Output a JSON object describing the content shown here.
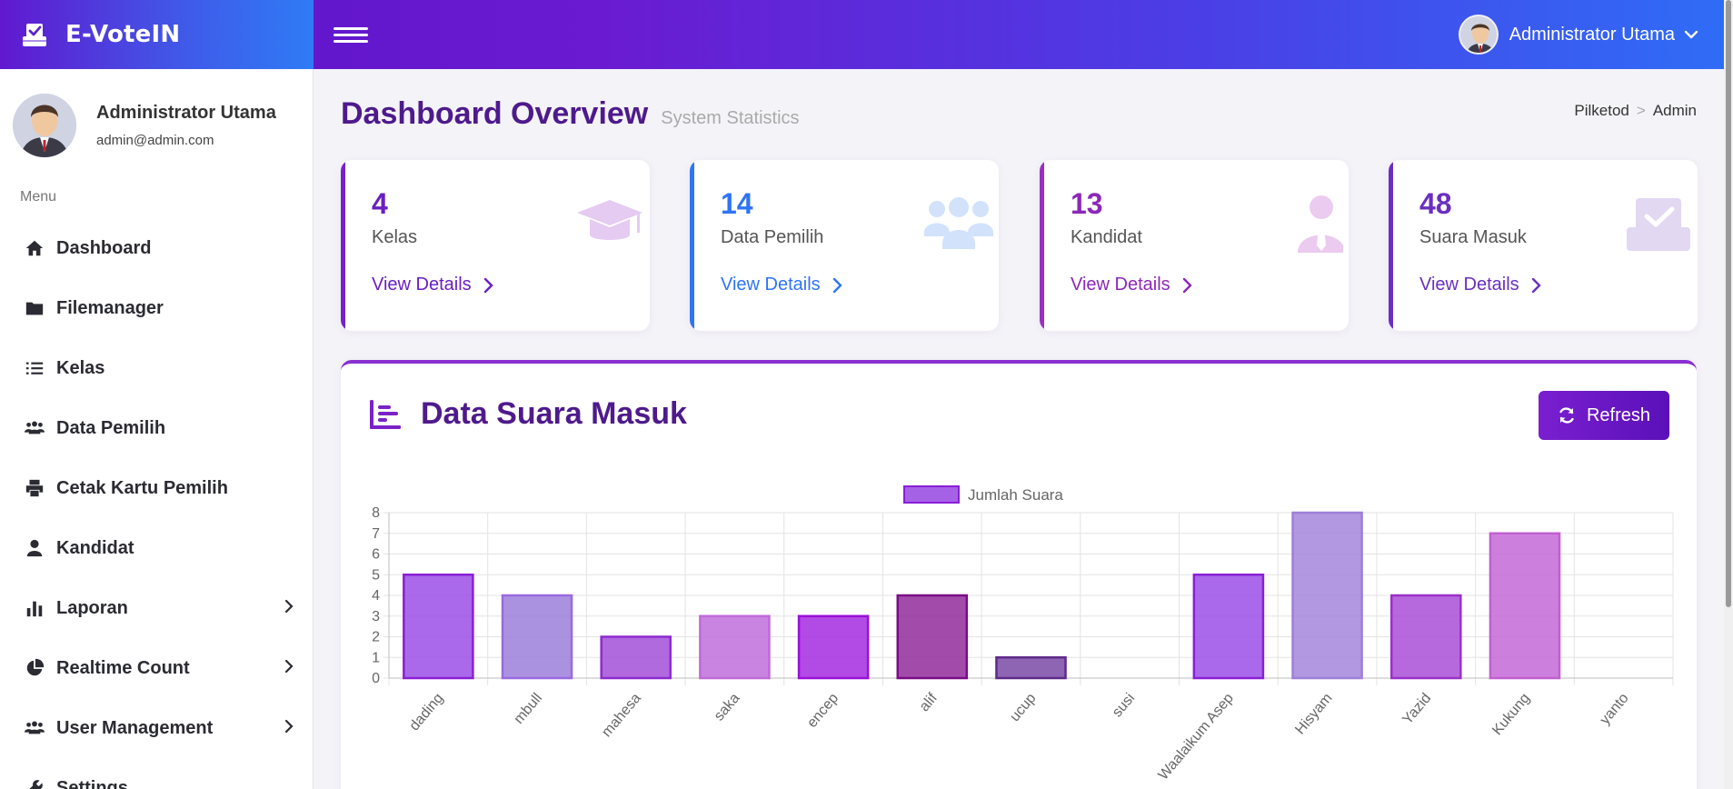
{
  "app": {
    "brand": "E-VoteIN"
  },
  "topbar": {
    "user_name": "Administrator Utama"
  },
  "sidebar": {
    "profile_name": "Administrator Utama",
    "profile_email": "admin@admin.com",
    "menu_heading": "Menu",
    "items": [
      {
        "label": "Dashboard",
        "icon": "home-icon",
        "has_submenu": false
      },
      {
        "label": "Filemanager",
        "icon": "folder-icon",
        "has_submenu": false
      },
      {
        "label": "Kelas",
        "icon": "list-icon",
        "has_submenu": false
      },
      {
        "label": "Data Pemilih",
        "icon": "users-icon",
        "has_submenu": false
      },
      {
        "label": "Cetak Kartu Pemilih",
        "icon": "printer-icon",
        "has_submenu": false
      },
      {
        "label": "Kandidat",
        "icon": "user-icon",
        "has_submenu": false
      },
      {
        "label": "Laporan",
        "icon": "bar-chart-icon",
        "has_submenu": true
      },
      {
        "label": "Realtime Count",
        "icon": "pie-chart-icon",
        "has_submenu": true
      },
      {
        "label": "User Management",
        "icon": "users-icon",
        "has_submenu": true
      },
      {
        "label": "Settings",
        "icon": "wrench-icon",
        "has_submenu": false
      }
    ]
  },
  "header": {
    "title": "Dashboard Overview",
    "subtitle": "System Statistics",
    "breadcrumb": [
      "Pilketod",
      "Admin"
    ]
  },
  "cards": [
    {
      "value": "4",
      "label": "Kelas",
      "link": "View Details",
      "color": "#7422c9",
      "icon": "graduation-cap-icon"
    },
    {
      "value": "14",
      "label": "Data Pemilih",
      "link": "View Details",
      "color": "#2f74f5",
      "icon": "users-icon"
    },
    {
      "value": "13",
      "label": "Kandidat",
      "link": "View Details",
      "color": "#9a2fc2",
      "icon": "user-tie-icon"
    },
    {
      "value": "48",
      "label": "Suara Masuk",
      "link": "View Details",
      "color": "#6a2fc0",
      "icon": "vote-box-icon"
    }
  ],
  "panel": {
    "title": "Data Suara Masuk",
    "refresh_label": "Refresh"
  },
  "chart_data": {
    "type": "bar",
    "categories": [
      "dading",
      "mbull",
      "mahesa",
      "saka",
      "encep",
      "alif",
      "ucup",
      "susi",
      "Waalaikum Asep",
      "Hisyam",
      "Yazid",
      "Kukung",
      "yanto"
    ],
    "series": [
      {
        "name": "Jumlah Suara",
        "values": [
          5,
          4,
          2,
          3,
          3,
          4,
          1,
          0,
          5,
          8,
          4,
          7,
          0
        ]
      }
    ],
    "ylim": [
      0,
      8
    ],
    "yticks": [
      0,
      1,
      2,
      3,
      4,
      5,
      6,
      7,
      8
    ],
    "grid": true,
    "legend": "top-center",
    "bar_colors": [
      "#9b4fe6",
      "#9c7fdc",
      "#a34fd8",
      "#c06fdc",
      "#a52ae0",
      "#922c9c",
      "#7a4aa6",
      "#b06ed8",
      "#9b4fe6",
      "#a485dc",
      "#a94fd6",
      "#c468d8",
      "#a06ad8"
    ],
    "bar_borders": [
      "#8a1fd6",
      "#9a6ae0",
      "#8d2bd0",
      "#c06ad8",
      "#9a10d8",
      "#7a0b86",
      "#5f2a8a",
      "#a05ad0",
      "#8a1fd6",
      "#9d7fd8",
      "#9a30c8",
      "#c060d0",
      "#9860c8"
    ]
  }
}
